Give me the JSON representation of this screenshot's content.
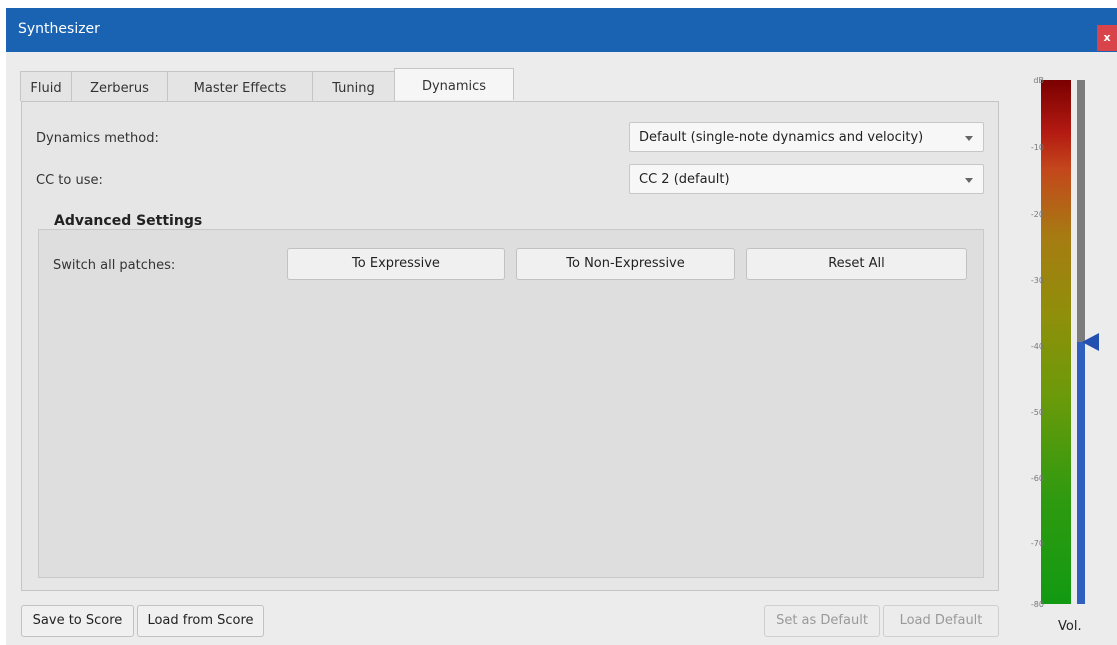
{
  "window": {
    "title": "Synthesizer",
    "close_glyph": "x"
  },
  "tabs": [
    {
      "label": "Fluid"
    },
    {
      "label": "Zerberus"
    },
    {
      "label": "Master Effects"
    },
    {
      "label": "Tuning"
    },
    {
      "label": "Dynamics",
      "active": true
    }
  ],
  "dynamics": {
    "method_label": "Dynamics method:",
    "method_value": "Default (single-note dynamics and velocity)",
    "cc_label": "CC to use:",
    "cc_value": "CC 2 (default)"
  },
  "advanced": {
    "title": "Advanced Settings",
    "switch_label": "Switch all patches:",
    "to_expressive": "To Expressive",
    "to_non_expressive": "To Non-Expressive",
    "reset_all": "Reset All"
  },
  "footer": {
    "save_to_score": "Save to Score",
    "load_from_score": "Load from Score",
    "set_as_default": "Set as Default",
    "load_default": "Load Default"
  },
  "meter": {
    "ticks": [
      "dB",
      "-10",
      "-20",
      "-30",
      "-40",
      "-50",
      "-60",
      "-70",
      "-80"
    ],
    "volume_db": -40,
    "vol_label": "Vol."
  },
  "colors": {
    "title_bar": "#1a63b3",
    "close_button": "#d9434a",
    "volume_handle": "#2350b0"
  },
  "icons": {
    "close": "close-icon",
    "dropdown": "chevron-down-icon",
    "volume_handle": "triangle-left-icon"
  }
}
